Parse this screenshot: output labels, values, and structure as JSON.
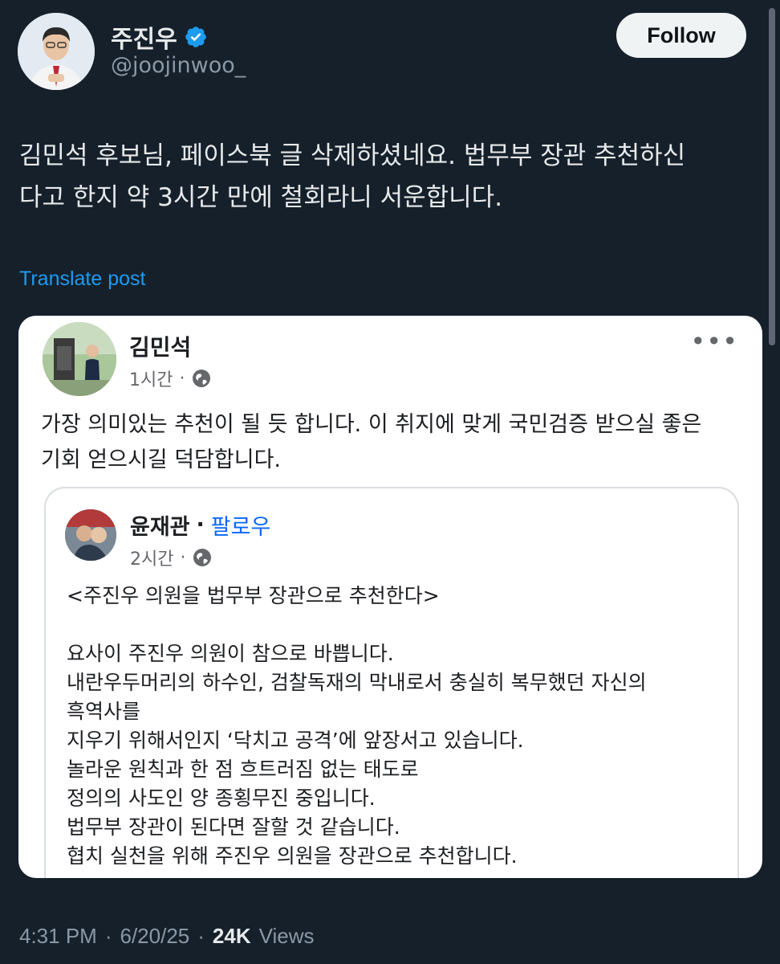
{
  "author": {
    "display_name": "주진우",
    "handle": "@joojinwoo_",
    "verified": true
  },
  "follow_button": {
    "label": "Follow"
  },
  "tweet": {
    "lines": [
      "김민석 후보님, 페이스북 글 삭제하셨네요. 법무부 장관 추천하신",
      "다고 한지 약 3시간 만에 철회라니 서운합니다."
    ],
    "translate_label": "Translate post"
  },
  "fb_post": {
    "author_name": "김민석",
    "time": "1시간",
    "dot": "·",
    "more": "•••",
    "lines": [
      "가장 의미있는 추천이 될 듯 합니다. 이 취지에 맞게 국민검증 받으실 좋은",
      "기회 얻으시길 덕담합니다."
    ],
    "shared": {
      "author_name": "윤재관",
      "dot": "·",
      "follow_label": "팔로우",
      "time": "2시간",
      "title": "<주진우 의원을 법무부 장관으로 추천한다>",
      "lines": [
        "요사이 주진우 의원이 참으로 바쁩니다.",
        "내란우두머리의 하수인, 검찰독재의 막내로서 충실히 복무했던 자신의",
        "흑역사를",
        "지우기 위해서인지 ‘닥치고 공격’에 앞장서고 있습니다.",
        "놀라운 원칙과 한 점 흐트러짐 없는 태도로",
        "정의의 사도인 양 종횡무진 중입니다.",
        "법무부 장관이 된다면 잘할 것 같습니다.",
        "협치 실천을 위해 주진우 의원을 장관으로 추천합니다."
      ]
    }
  },
  "footer": {
    "time": "4:31 PM",
    "sep1": "·",
    "date": "6/20/25",
    "sep2": "·",
    "views_count": "24K",
    "views_label": "Views"
  },
  "colors": {
    "background": "#15202b",
    "accent_link": "#1d9bf0",
    "verified_badge": "#1d9bf0",
    "fb_follow_link": "#0866ff"
  },
  "icons": [
    "verified-badge-icon",
    "globe-icon",
    "more-options-icon"
  ]
}
